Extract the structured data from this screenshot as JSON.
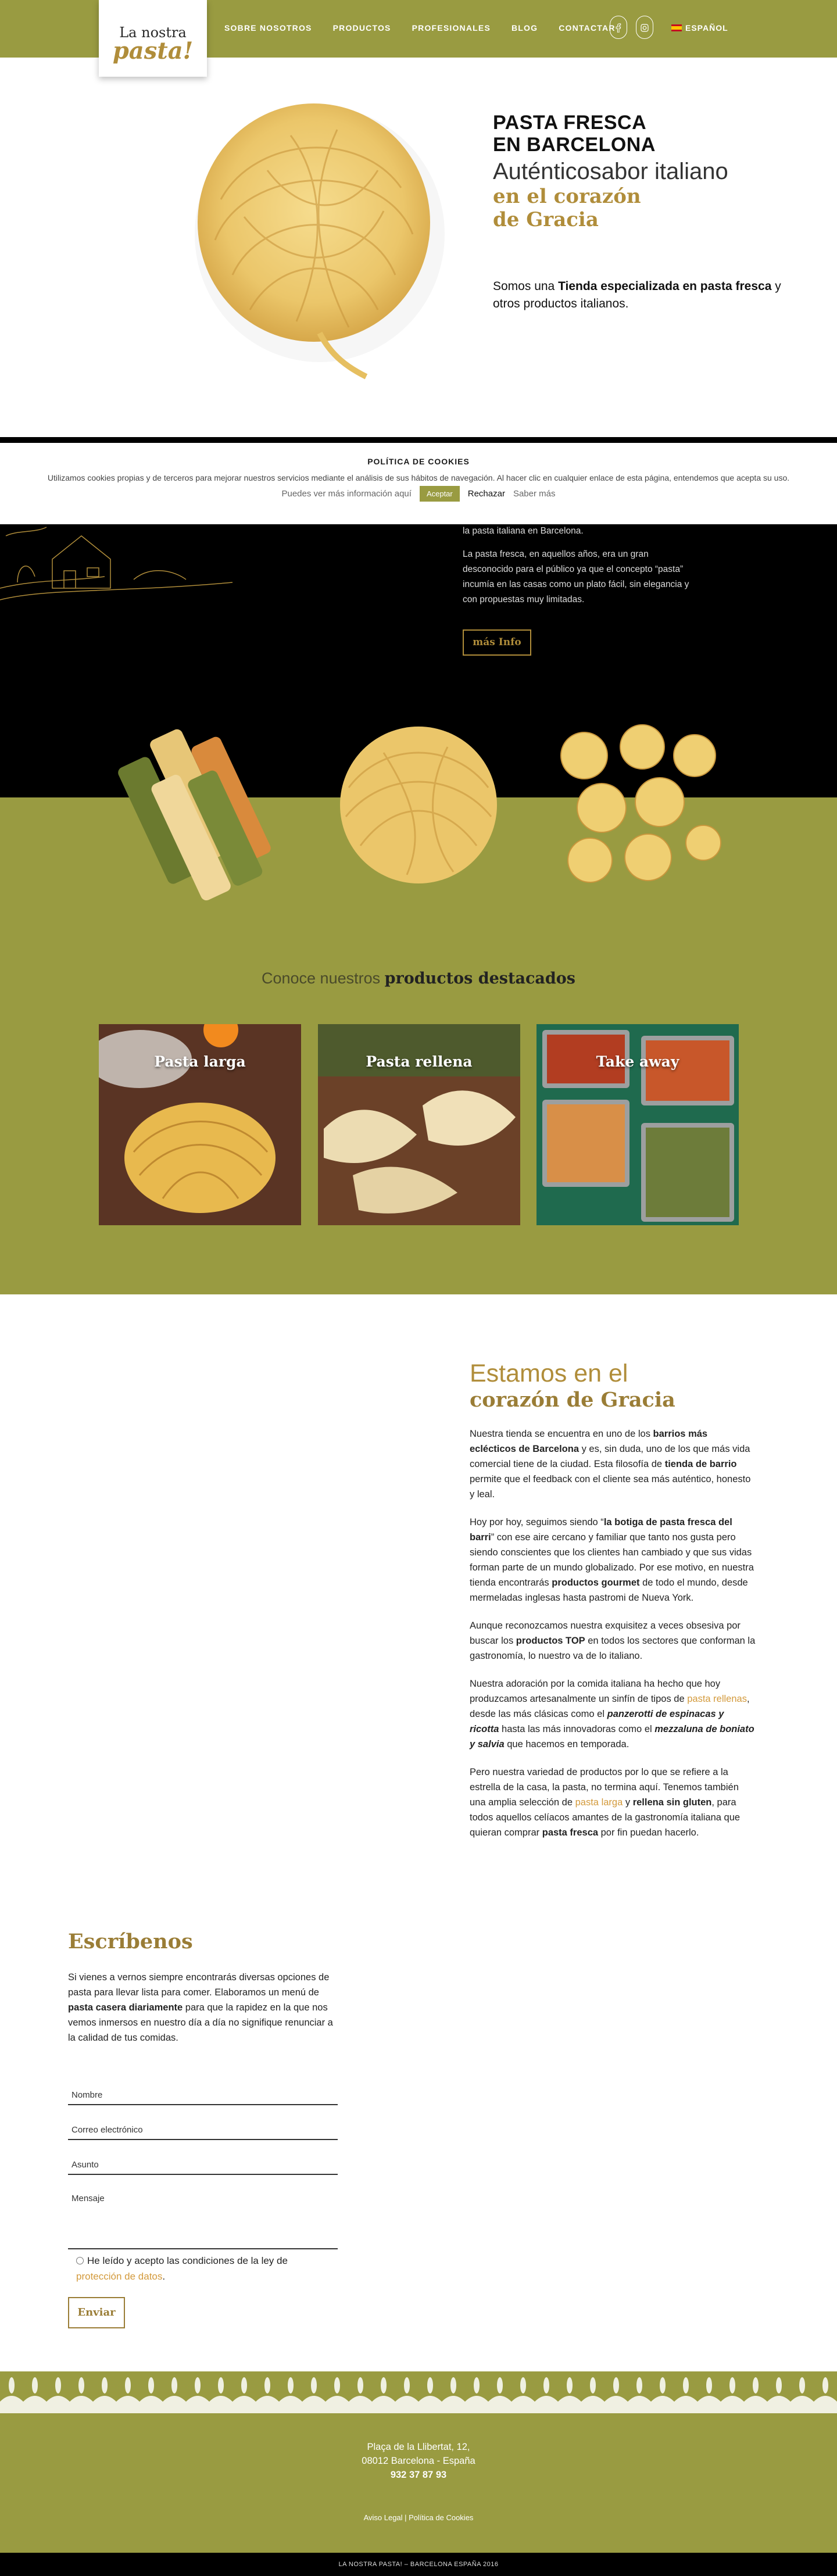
{
  "header": {
    "logo_line1": "La nostra",
    "logo_line2": "pasta!",
    "nav": [
      "SOBRE NOSOTROS",
      "PRODUCTOS",
      "PROFESIONALES",
      "BLOG",
      "CONTACTAR"
    ],
    "language": "ESPAÑOL",
    "brand_color": "#999b41",
    "accent_color": "#b08d3a"
  },
  "hero": {
    "title_line1": "PASTA FRESCA",
    "title_line2": "EN BARCELONA",
    "subtitle": "Auténticosabor italiano",
    "gold_line1": "en el corazón",
    "gold_line2": "de Gracia",
    "desc_pre": "Somos una ",
    "desc_bold1": "Tienda especializada en pasta fresca",
    "desc_post": " y otros productos italianos."
  },
  "cookies": {
    "title": "POLÍTICA DE COOKIES",
    "text": "Utilizamos cookies propias y de terceros para mejorar nuestros servicios mediante el análisis de sus hábitos de navegación. Al hacer clic en cualquier enlace de esta página, entendemos que acepta su uso.",
    "more_info": "Puedes ver más información aquí",
    "accept": "Aceptar",
    "reject": "Rechazar",
    "learn_more": "Saber más"
  },
  "about": {
    "p1": "la pasta italiana en Barcelona.",
    "p2": "La pasta fresca, en aquellos años, era un gran desconocido para el público ya que el concepto “pasta” incumía en las casas como un plato fácil, sin elegancia y con propuestas muy limitadas.",
    "button": "más Info"
  },
  "featured": {
    "heading_light": "Conoce nuestros ",
    "heading_bold": "productos destacados",
    "cards": [
      {
        "label": "Pasta larga"
      },
      {
        "label": "Pasta rellena"
      },
      {
        "label": "Take away"
      }
    ]
  },
  "estamos": {
    "heading1": "Estamos en el",
    "heading2": "corazón de Gracia",
    "p1_a": "Nuestra tienda se encuentra en uno de los ",
    "p1_b": "barrios más eclécticos de Barcelona",
    "p1_c": " y es, sin duda, uno de los que más vida comercial tiene de la ciudad. Esta filosofía de ",
    "p1_d": "tienda de barrio",
    "p1_e": " permite que el feedback con el cliente sea más auténtico, honesto y leal.",
    "p2_a": "Hoy por hoy, seguimos siendo “",
    "p2_b": "la botiga de pasta fresca del barri",
    "p2_c": "” con ese aire cercano y familiar que tanto nos gusta pero siendo conscientes que los clientes han cambiado y que sus vidas forman parte de un mundo globalizado. Por ese motivo, en nuestra tienda encontrarás ",
    "p2_d": "productos gourmet",
    "p2_e": " de todo el mundo, desde mermeladas inglesas hasta pastromi de Nueva York.",
    "p3_a": "Aunque reconozcamos nuestra exquisitez a veces obsesiva por buscar los ",
    "p3_b": "productos TOP",
    "p3_c": " en todos los sectores que conforman la gastronomía, lo nuestro va de lo italiano.",
    "p4_a": "Nuestra adoración por la comida italiana ha hecho que hoy produzcamos artesanalmente un sinfín de tipos de ",
    "p4_link": "pasta rellenas",
    "p4_b": ", desde las más clásicas como el ",
    "p4_c": "panzerotti de espinacas y ricotta",
    "p4_d": " hasta las más innovadoras como el ",
    "p4_e": "mezzaluna de boniato y salvia",
    "p4_f": " que hacemos en temporada.",
    "p5_a": "Pero nuestra variedad de productos por lo que se refiere a la estrella de la casa, la pasta, no termina aquí. Tenemos también una amplia selección de ",
    "p5_link": "pasta larga",
    "p5_b": " y ",
    "p5_c": "rellena sin gluten",
    "p5_d": ", para todos aquellos celíacos amantes de la gastronomía italiana que quieran comprar ",
    "p5_e": "pasta fresca",
    "p5_f": " por fin puedan hacerlo."
  },
  "contact": {
    "heading": "Escríbenos",
    "text_a": "Si vienes a vernos siempre encontrarás diversas opciones de pasta para llevar lista para comer. Elaboramos un menú de ",
    "text_b": "pasta casera diariamente",
    "text_c": " para que la rapidez en la que nos vemos inmersos en nuestro día a día no signifique renunciar a  la calidad de tus comidas.",
    "name_placeholder": "Nombre",
    "email_placeholder": "Correo electrónico",
    "subject_placeholder": "Asunto",
    "message_placeholder": "Mensaje",
    "consent_a": "He leído y acepto las condiciones de la ley de ",
    "consent_link": "protección de datos",
    "consent_b": ".",
    "submit": "Enviar"
  },
  "footer": {
    "address1": "Plaça de la Llibertat, 12,",
    "address2": "08012 Barcelona - España",
    "phone": "932 37 87 93",
    "legal": "Aviso Legal | Política de Cookies",
    "copyright": "LA NOSTRA PASTA! – BARCELONA ESPAÑA 2016"
  }
}
